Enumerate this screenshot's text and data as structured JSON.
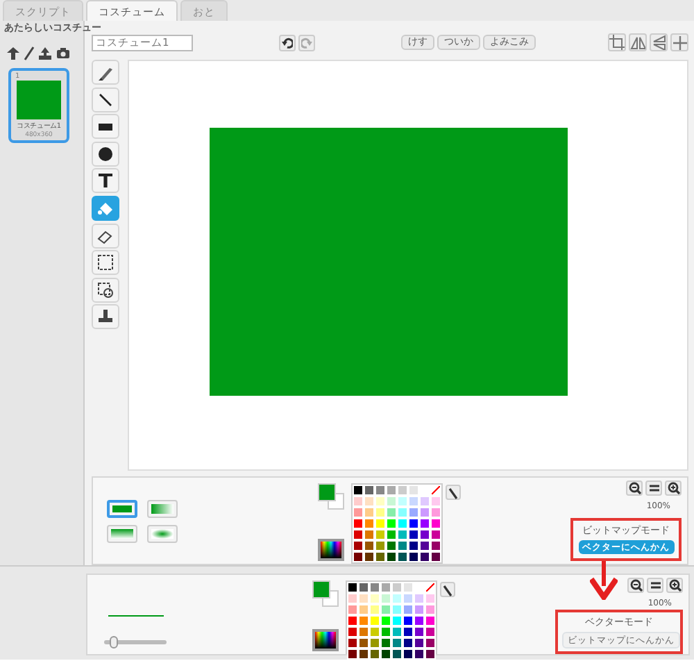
{
  "tabs": [
    {
      "label": "スクリプト",
      "selected": false
    },
    {
      "label": "コスチューム",
      "selected": true
    },
    {
      "label": "おと",
      "selected": false
    }
  ],
  "sidebar": {
    "title": "あたらしいコスチュー",
    "costumes": [
      {
        "number": "1",
        "name": "コスチューム1",
        "size": "480x360",
        "selected": true
      }
    ]
  },
  "editor": {
    "costume_name": "コスチューム1",
    "buttons": [
      "けす",
      "ついか",
      "よみこみ"
    ],
    "tools": [
      {
        "kind": "brush",
        "selected": false
      },
      {
        "kind": "line",
        "selected": false
      },
      {
        "kind": "rect",
        "selected": false
      },
      {
        "kind": "ellipse",
        "selected": false
      },
      {
        "kind": "text",
        "selected": false
      },
      {
        "kind": "fill",
        "selected": true
      },
      {
        "kind": "eraser",
        "selected": false
      },
      {
        "kind": "select",
        "selected": false
      },
      {
        "kind": "stamp-select",
        "selected": false
      },
      {
        "kind": "stamp",
        "selected": false
      }
    ],
    "fill_types": [
      {
        "kind": "solid",
        "selected": true
      },
      {
        "kind": "horizontal",
        "selected": false
      },
      {
        "kind": "vertical",
        "selected": false
      },
      {
        "kind": "radial",
        "selected": false
      }
    ],
    "zoom": "100%",
    "mode": "ビットマップモード",
    "convert_button": "ベクターにへんかん"
  },
  "vector_panel": {
    "brush_size": {
      "level": 0.1
    },
    "zoom": "100%",
    "mode": "ベクターモード",
    "convert_button": "ビットマップにへんかん"
  }
}
